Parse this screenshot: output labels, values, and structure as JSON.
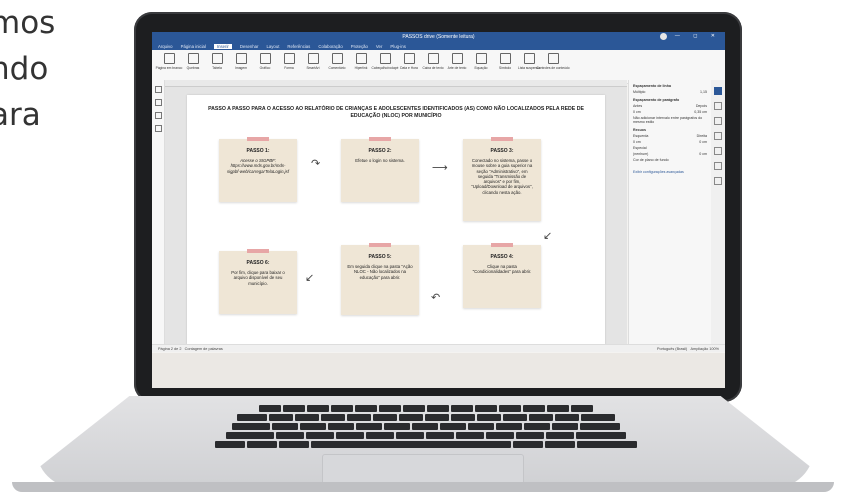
{
  "side_text": [
    "mos",
    "ndo",
    "ara"
  ],
  "window": {
    "title": "PASSOS drive (Somente leitura)",
    "controls": "—  ◻  ✕"
  },
  "menu": [
    {
      "label": "Arquivo"
    },
    {
      "label": "Página inicial"
    },
    {
      "label": "Inserir",
      "active": true
    },
    {
      "label": "Desenhar"
    },
    {
      "label": "Layout"
    },
    {
      "label": "Referências"
    },
    {
      "label": "Colaboração"
    },
    {
      "label": "Proteção"
    },
    {
      "label": "Ver"
    },
    {
      "label": "Plug-ins"
    }
  ],
  "ribbon": [
    {
      "label": "Página em branco"
    },
    {
      "label": "Quebras"
    },
    {
      "label": "Tabela"
    },
    {
      "label": "Imagem"
    },
    {
      "label": "Gráfico"
    },
    {
      "label": "Forma"
    },
    {
      "label": "SmartArt"
    },
    {
      "label": "Comentário"
    },
    {
      "label": "Hiperlink"
    },
    {
      "label": "Cabeçalho/rodapé"
    },
    {
      "label": "Data e Hora"
    },
    {
      "label": "Caixa de texto"
    },
    {
      "label": "Arte de texto"
    },
    {
      "label": "Equação"
    },
    {
      "label": "Símbolo"
    },
    {
      "label": "Lista suspensa"
    },
    {
      "label": "Controles de conteúdo"
    }
  ],
  "document": {
    "title": "PASSO A PASSO PARA O ACESSO AO RELATÓRIO DE CRIANÇAS E ADOLESCENTES IDENTIFICADOS (AS) COMO NÃO LOCALIZADOS PELA REDE DE EDUCAÇÃO (NLOC) POR MUNICÍPIO",
    "steps": [
      {
        "title": "PASSO 1:",
        "body": "Acesse o SIGPBF: https://www.mds.gov.br/mds-sigpbf-web/carregarTelaLogin.jsf"
      },
      {
        "title": "PASSO 2:",
        "body": "Efetue o login no sistema."
      },
      {
        "title": "PASSO 3:",
        "body": "Conectado no sistema, passe o mouse sobre a guia superior na seção \"Administrativo\", em seguida \"Transmissão de arquivos\" e por fim, \"Upload/Download de arquivos\", clicando nesta ação."
      },
      {
        "title": "PASSO 4:",
        "body": "Clique na pasta \"Condicionalidades\" para abrir."
      },
      {
        "title": "PASSO 5:",
        "body": "Em seguida clique na pasta \"Ação NLOC - Não localizados na educação\" para abrir."
      },
      {
        "title": "PASSO 6:",
        "body": "Por fim, clique para baixar o arquivo disponível de seu município."
      }
    ]
  },
  "right_panel": {
    "heading": "Espaçamento de linha",
    "line_mode": "Múltiplo",
    "line_value": "1,15",
    "para_heading": "Espaçamento de parágrafo",
    "before_label": "Antes",
    "after_label": "Depois",
    "before_value": "0 cm",
    "after_value": "0,35 cm",
    "no_space_label": "Não adicionar intervalo entre parágrafos do mesmo estilo",
    "indent_heading": "Recuos",
    "left_label": "Esquerda",
    "right_label": "Direita",
    "left_value": "0 cm",
    "right_value": "0 cm",
    "special_label": "Especial",
    "special_value": "(nenhum)",
    "special_by": "0 cm",
    "bg_color_label": "Cor de plano de fundo",
    "advanced_link": "Exibir configurações avançadas"
  },
  "status": {
    "page": "Página 2 de 2",
    "word_count": "Contagem de palavras",
    "language": "Português (Brasil)",
    "zoom": "Ampliação 100%"
  }
}
